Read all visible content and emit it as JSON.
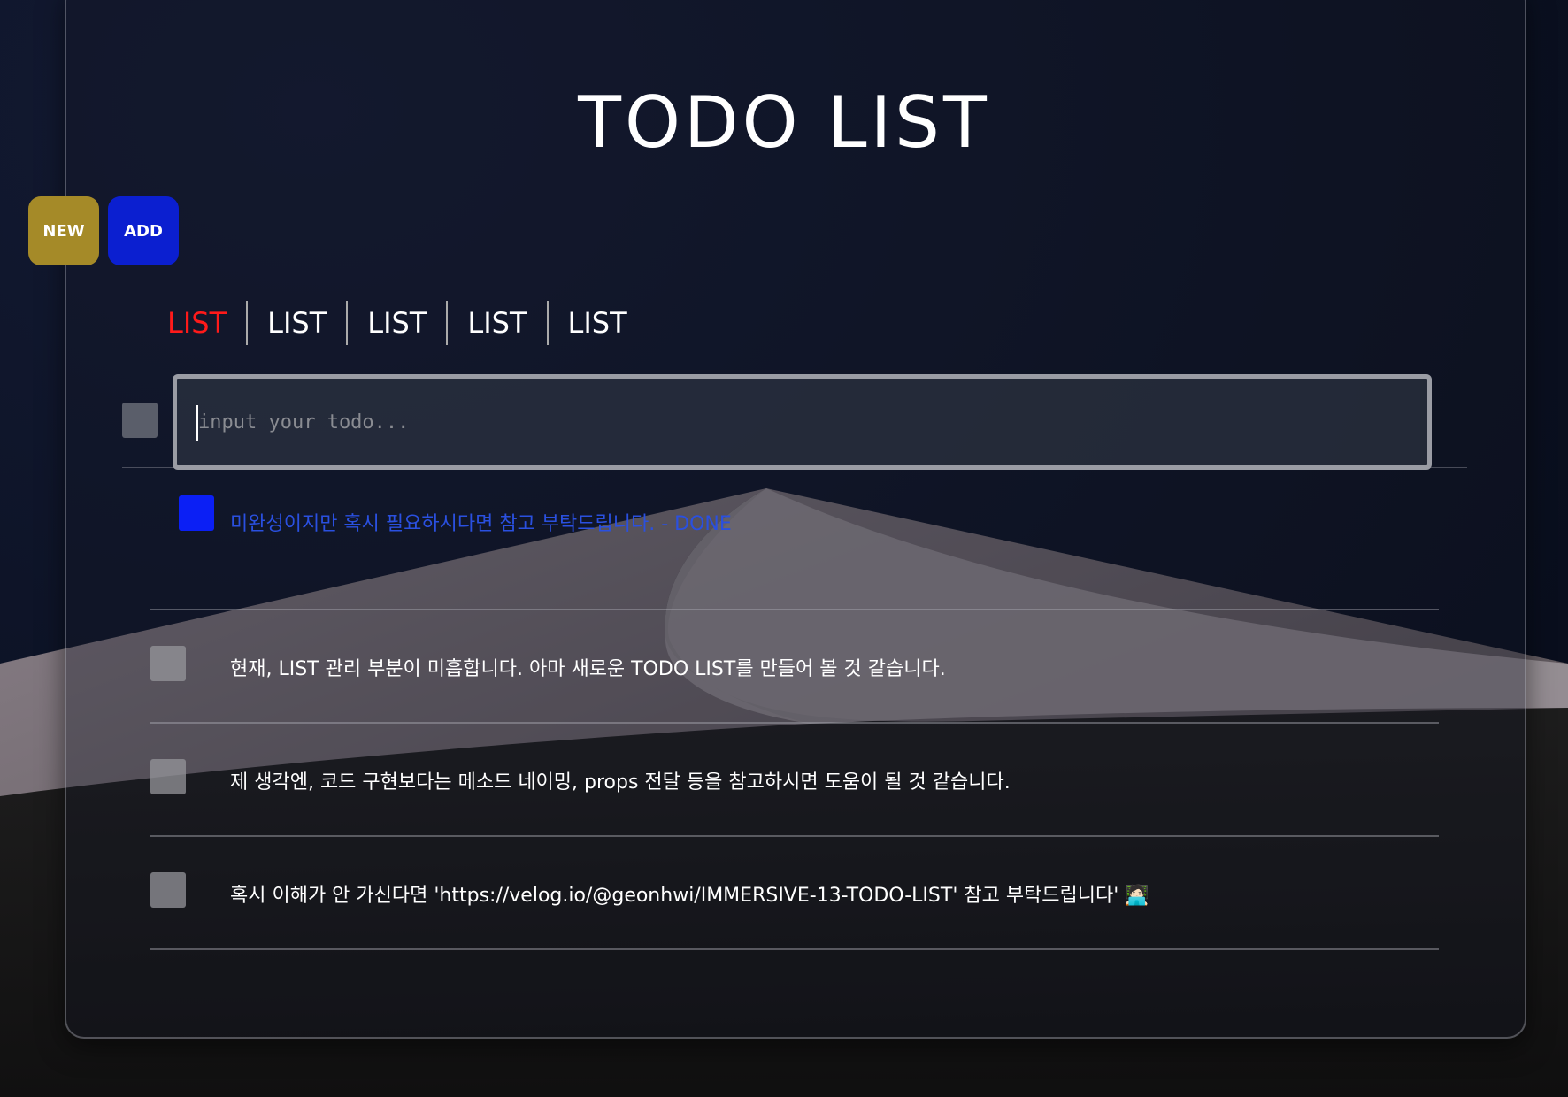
{
  "header": {
    "title": "TODO LIST"
  },
  "buttons": {
    "new": "NEW",
    "add": "ADD"
  },
  "tabs": [
    "LIST",
    "LIST",
    "LIST",
    "LIST",
    "LIST"
  ],
  "input": {
    "placeholder": "input your todo...",
    "value": ""
  },
  "todos": [
    {
      "text": "미완성이지만 혹시 필요하시다면 참고 부탁드립니다. - DONE",
      "done": true
    },
    {
      "text": "현재, LIST 관리 부분이 미흡합니다. 아마 새로운 TODO LIST를 만들어 볼 것 같습니다.",
      "done": false
    },
    {
      "text": "제 생각엔, 코드 구현보다는 메소드 네이밍, props 전달 등을 참고하시면 도움이 될 것 같습니다.",
      "done": false
    },
    {
      "text": "혹시 이해가 안 가신다면 'https://velog.io/@geonhwi/IMMERSIVE-13-TODO-LIST' 참고 부탁드립니다' 🧑🏻‍💻",
      "done": false
    }
  ],
  "colors": {
    "active_tab": "#ff1a1a",
    "new_button": "#a58a28",
    "add_button": "#0b1fd0",
    "done_text": "#2a50e0"
  }
}
